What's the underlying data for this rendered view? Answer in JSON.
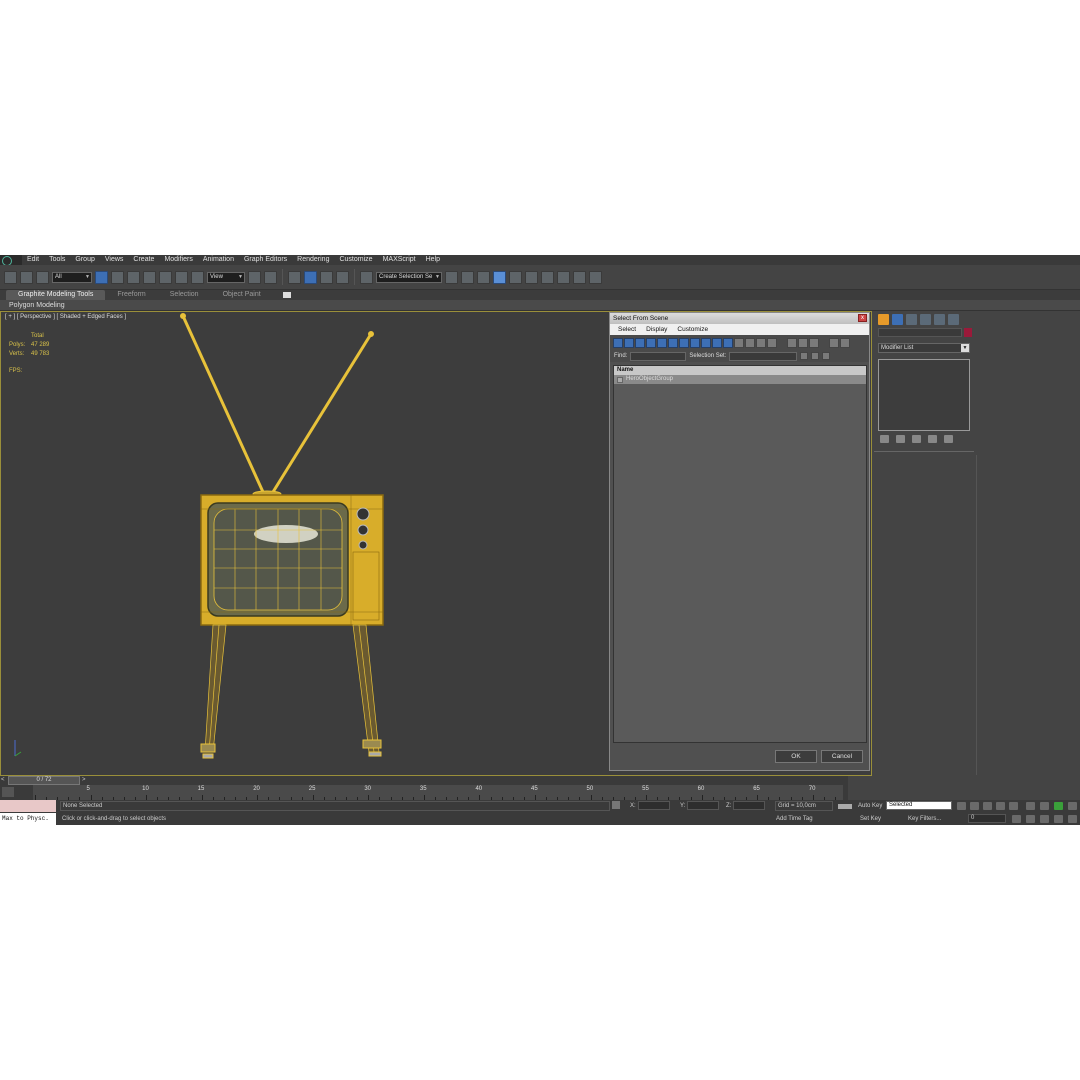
{
  "menubar": {
    "items": [
      "Edit",
      "Tools",
      "Group",
      "Views",
      "Create",
      "Modifiers",
      "Animation",
      "Graph Editors",
      "Rendering",
      "Customize",
      "MAXScript",
      "Help"
    ]
  },
  "toolbar": {
    "selection_filter": "All",
    "reference_coord": "View",
    "named_selection": "Create Selection Se"
  },
  "ribbon": {
    "tabs": [
      "Graphite Modeling Tools",
      "Freeform",
      "Selection",
      "Object Paint"
    ],
    "panel_label": "Polygon Modeling"
  },
  "viewport": {
    "label": "[ + ] [ Perspective ] [ Shaded + Edged Faces ]",
    "stats": {
      "header": "Total",
      "polys_label": "Polys:",
      "polys_value": "47 289",
      "verts_label": "Verts:",
      "verts_value": "49 783",
      "fps_label": "FPS:"
    }
  },
  "dialog": {
    "title": "Select From Scene",
    "close": "x",
    "menu": [
      "Select",
      "Display",
      "Customize"
    ],
    "find_label": "Find:",
    "selset_label": "Selection Set:",
    "list_header": "Name",
    "rows": [
      "HeroObjectGroup"
    ],
    "ok": "OK",
    "cancel": "Cancel"
  },
  "command_panel": {
    "modifier_list": "Modifier List"
  },
  "timeslider": {
    "frame": "0 / 72",
    "prev": "<",
    "next": ">"
  },
  "trackbar": {
    "ticks": [
      "5",
      "10",
      "15",
      "20",
      "25",
      "30",
      "35",
      "40",
      "45",
      "50",
      "55",
      "60",
      "65",
      "70"
    ]
  },
  "status": {
    "max_to_physc": "Max to Physc.",
    "selection": "None Selected",
    "prompt": "Click or click-and-drag to select objects",
    "x_label": "X:",
    "y_label": "Y:",
    "z_label": "Z:",
    "grid": "Grid = 10,0cm",
    "add_time_tag": "Add Time Tag",
    "auto_key": "Auto Key",
    "set_key": "Set Key",
    "key_mode": "Selected",
    "key_filters": "Key Filters...",
    "frame_number": "0"
  },
  "colors": {
    "wireframe": "#e8c23a",
    "viewport_bg": "#3d3d3d",
    "accent_blue": "#3d6fb5"
  }
}
